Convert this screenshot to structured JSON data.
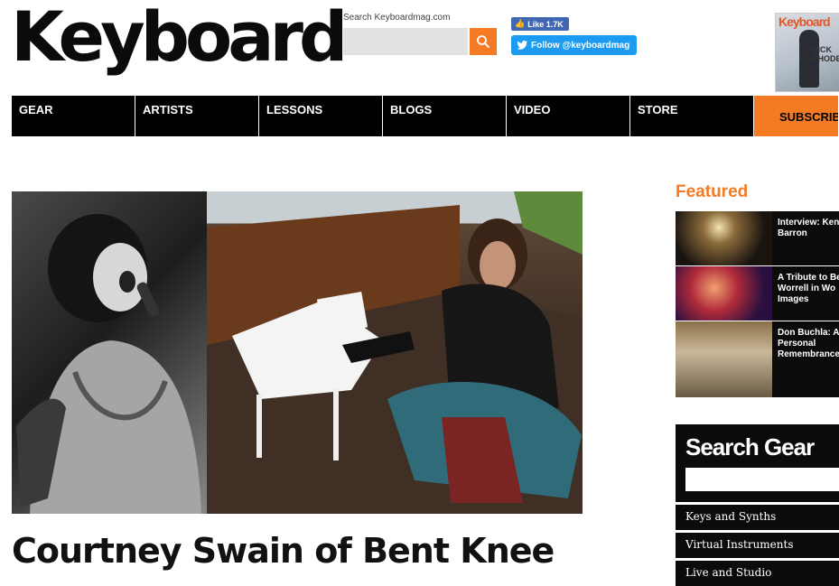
{
  "header": {
    "logo": "Keyboard",
    "search_label": "Search Keyboardmag.com",
    "search_placeholder": "",
    "facebook_like": "Like 1.7K",
    "twitter_follow": "Follow @keyboardmag",
    "magazine_masthead": "Keyboard",
    "magazine_cover_text": "NICK RHODES"
  },
  "nav": {
    "items": [
      "GEAR",
      "ARTISTS",
      "LESSONS",
      "BLOGS",
      "VIDEO",
      "STORE"
    ],
    "subscribe": "SUBSCRIBE"
  },
  "article": {
    "title": "Courtney Swain of Bent Knee"
  },
  "sidebar": {
    "featured_heading": "Featured",
    "featured": [
      {
        "text": "Interview: Ken\nBarron"
      },
      {
        "text": "A Tribute to Be\nWorrell in Wo\nImages"
      },
      {
        "text": "Don Buchla: A\nPersonal\nRemembrance"
      }
    ],
    "search_gear": {
      "title": "Search Gear",
      "placeholder": "",
      "links": [
        "Keys and Synths",
        "Virtual Instruments",
        "Live and Studio"
      ]
    }
  },
  "colors": {
    "accent": "#f47a23",
    "nav_bg": "#000000",
    "facebook": "#4267b2",
    "twitter": "#1d9bf0"
  }
}
